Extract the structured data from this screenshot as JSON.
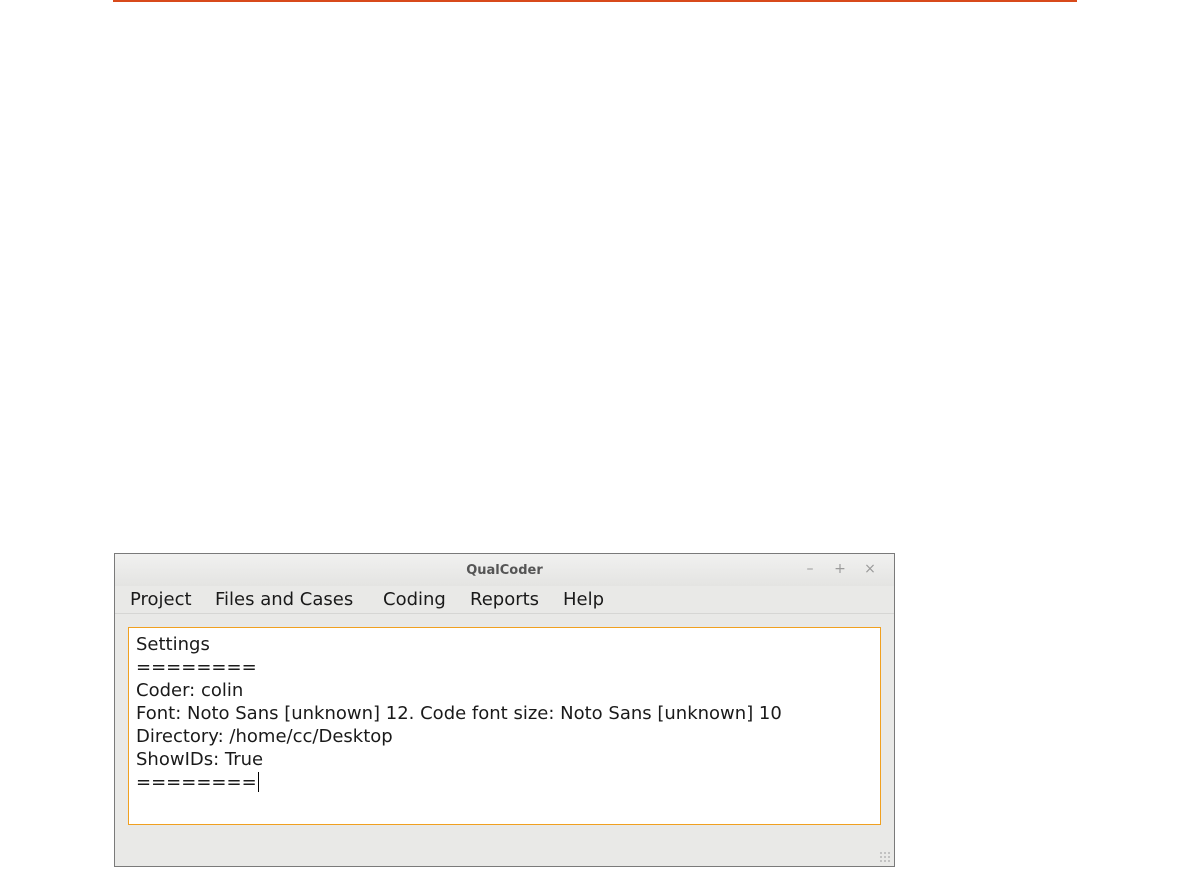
{
  "window": {
    "title": "QualCoder",
    "controls": {
      "minimize": "–",
      "maximize": "+",
      "close": "×"
    }
  },
  "menu": {
    "items": [
      {
        "label": "Project"
      },
      {
        "label": "Files and Cases"
      },
      {
        "label": "Coding"
      },
      {
        "label": "Reports"
      },
      {
        "label": "Help"
      }
    ]
  },
  "editor": {
    "lines": [
      "Settings",
      "========",
      "Coder: colin",
      "Font: Noto Sans [unknown] 12. Code font size: Noto Sans [unknown] 10",
      "Directory: /home/cc/Desktop",
      "ShowIDs: True",
      "========"
    ]
  },
  "colors": {
    "page_rule": "#d84a1b",
    "editor_focus_border": "#f0a020",
    "window_background": "#e9e9e7"
  }
}
